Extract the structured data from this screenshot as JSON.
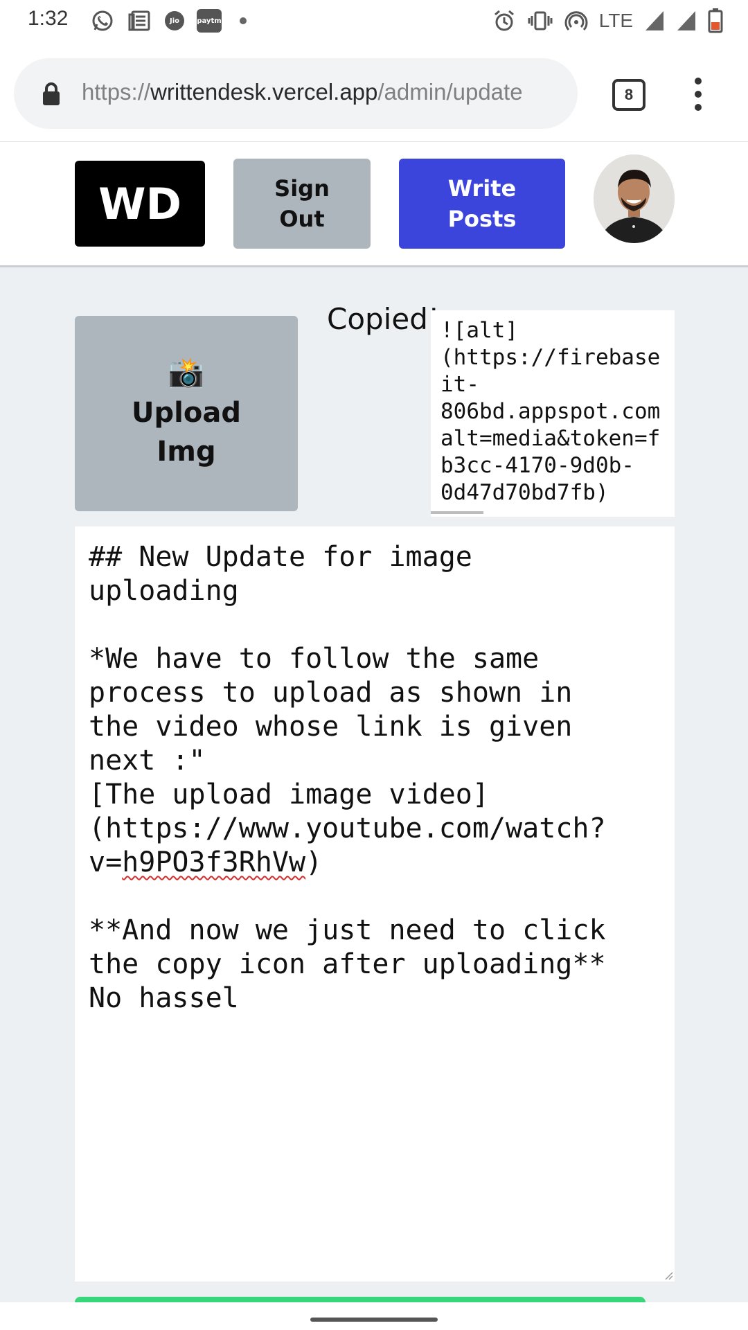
{
  "status_bar": {
    "time": "1:32",
    "left_icons": [
      "whatsapp-icon",
      "news-icon",
      "jio-icon",
      "paytm-icon",
      "notification-dot-icon"
    ],
    "jio_label": "Jio",
    "paytm_label": "paytm",
    "network": "LTE",
    "right_icons": [
      "alarm-icon",
      "vibrate-icon",
      "hotspot-icon",
      "signal-icon",
      "signal-icon",
      "battery-icon"
    ]
  },
  "browser": {
    "url_scheme": "https://",
    "url_host": "writtendesk.vercel.app",
    "url_path": "/admin/update",
    "tab_count": "8"
  },
  "header": {
    "logo": "WD",
    "sign_out_label": "Sign\nOut",
    "write_posts_label": "Write\nPosts",
    "accent": "#3b45dc"
  },
  "main": {
    "upload_icon": "📸",
    "upload_label": "Upload\nImg",
    "copied_text": "Copied!",
    "copied_link": "![alt]\n(https://firebase\nit-\n806bd.appspot.com\nalt=media&token=f\nb3cc-4170-9d0b-\n0d47d70bd7fb)",
    "editor": {
      "before": "## New Update for image\nuploading\n\n*We have to follow the same\nprocess to upload as shown in\nthe video whose link is given\nnext :\"\n[The upload image video]\n(https://www.youtube.com/watch?\nv=",
      "misspelled": "h9PO3f3RhVw",
      "after": ")\n\n**And now we just need to click\nthe copy icon after uploading**\nNo hassel"
    }
  },
  "colors": {
    "background": "#edf0f3",
    "gray_button": "#adb5bd",
    "green_bar": "#37d67a"
  }
}
